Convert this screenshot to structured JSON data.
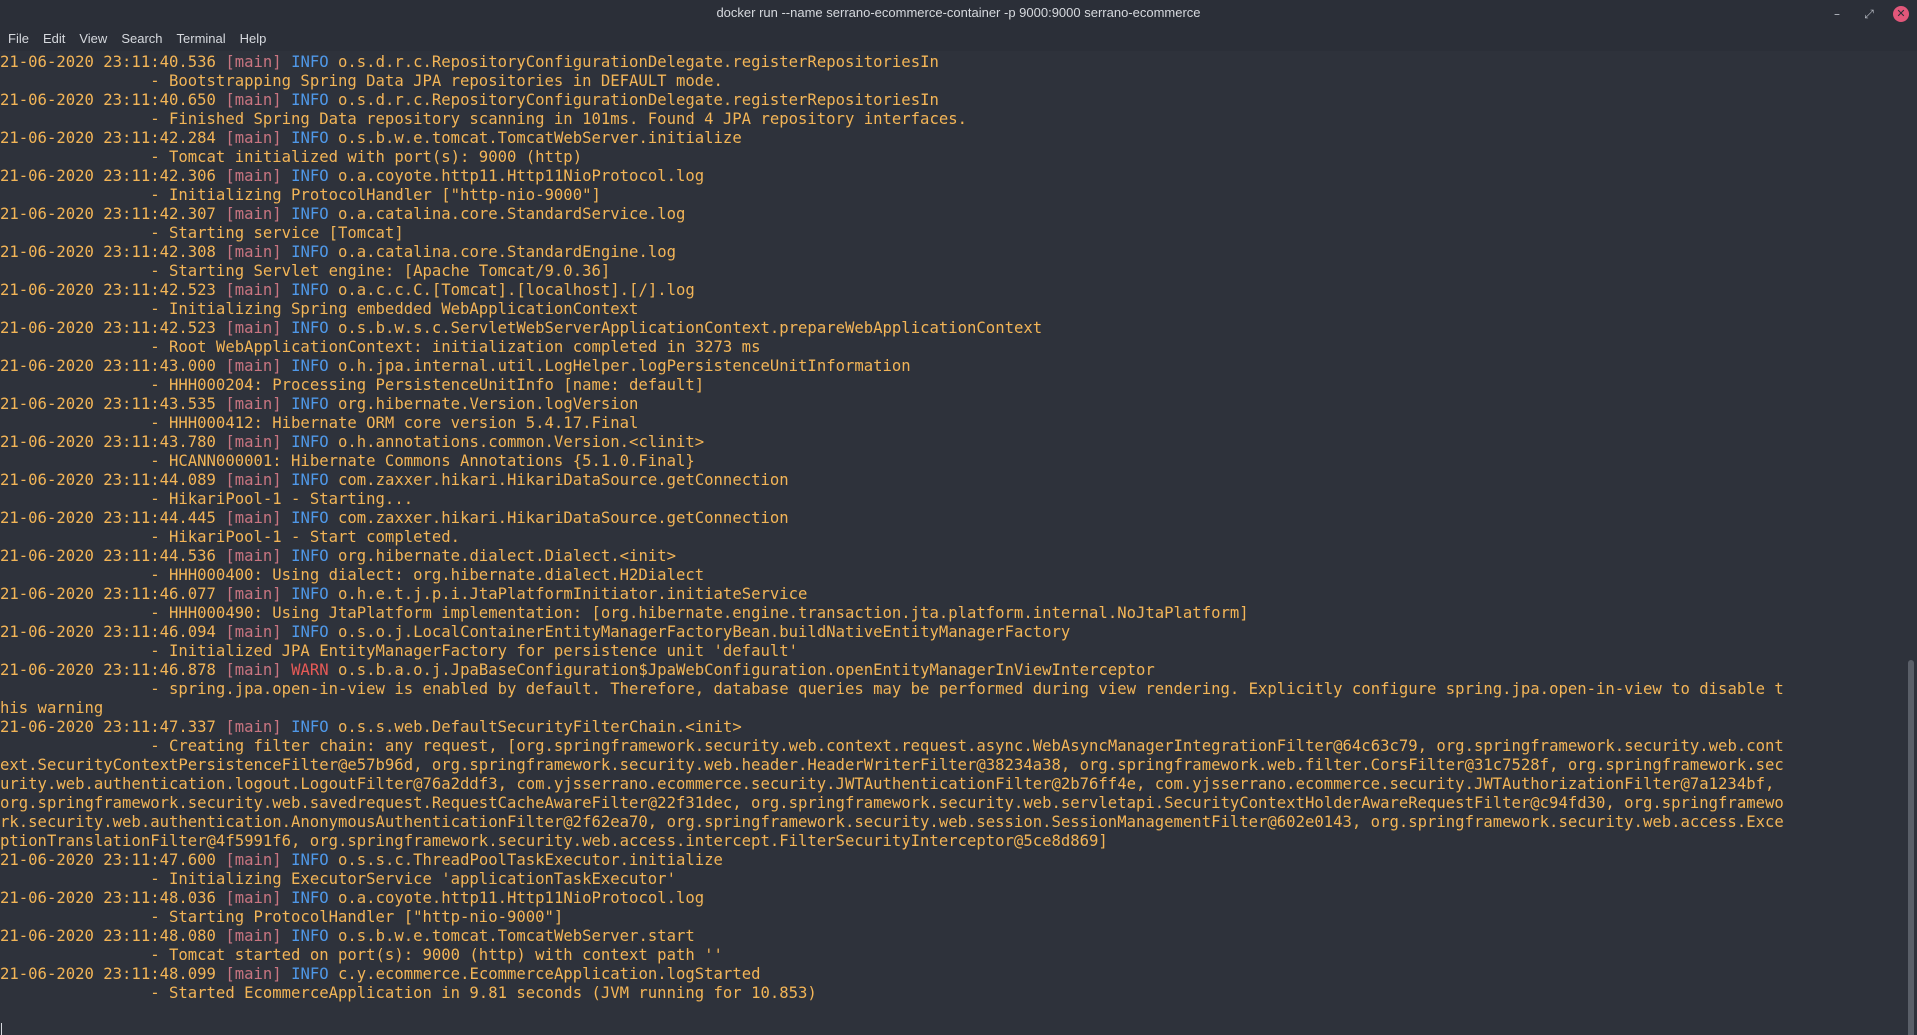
{
  "window": {
    "title": "docker run --name serrano-ecommerce-container -p 9000:9000 serrano-ecommerce",
    "controls": {
      "minimize": "–",
      "maximize": "⤢",
      "close": "✕"
    }
  },
  "menubar": {
    "items": [
      "File",
      "Edit",
      "View",
      "Search",
      "Terminal",
      "Help"
    ]
  },
  "colors": {
    "background": "#2e323b",
    "text": "#f3b557",
    "thread": "#c97581",
    "info": "#4f98e8",
    "warn": "#e65a57"
  },
  "terminal": {
    "indent": "                ",
    "lines": [
      {
        "type": "log",
        "ts": "21-06-2020 23:11:40.536",
        "thread": "[main]",
        "level": "INFO",
        "logger": "o.s.d.r.c.RepositoryConfigurationDelegate.registerRepositoriesIn"
      },
      {
        "type": "msg",
        "text": "- Bootstrapping Spring Data JPA repositories in DEFAULT mode."
      },
      {
        "type": "log",
        "ts": "21-06-2020 23:11:40.650",
        "thread": "[main]",
        "level": "INFO",
        "logger": "o.s.d.r.c.RepositoryConfigurationDelegate.registerRepositoriesIn"
      },
      {
        "type": "msg",
        "text": "- Finished Spring Data repository scanning in 101ms. Found 4 JPA repository interfaces."
      },
      {
        "type": "log",
        "ts": "21-06-2020 23:11:42.284",
        "thread": "[main]",
        "level": "INFO",
        "logger": "o.s.b.w.e.tomcat.TomcatWebServer.initialize"
      },
      {
        "type": "msg",
        "text": "- Tomcat initialized with port(s): 9000 (http)"
      },
      {
        "type": "log",
        "ts": "21-06-2020 23:11:42.306",
        "thread": "[main]",
        "level": "INFO",
        "logger": "o.a.coyote.http11.Http11NioProtocol.log"
      },
      {
        "type": "msg",
        "text": "- Initializing ProtocolHandler [\"http-nio-9000\"]"
      },
      {
        "type": "log",
        "ts": "21-06-2020 23:11:42.307",
        "thread": "[main]",
        "level": "INFO",
        "logger": "o.a.catalina.core.StandardService.log"
      },
      {
        "type": "msg",
        "text": "- Starting service [Tomcat]"
      },
      {
        "type": "log",
        "ts": "21-06-2020 23:11:42.308",
        "thread": "[main]",
        "level": "INFO",
        "logger": "o.a.catalina.core.StandardEngine.log"
      },
      {
        "type": "msg",
        "text": "- Starting Servlet engine: [Apache Tomcat/9.0.36]"
      },
      {
        "type": "log",
        "ts": "21-06-2020 23:11:42.523",
        "thread": "[main]",
        "level": "INFO",
        "logger": "o.a.c.c.C.[Tomcat].[localhost].[/].log"
      },
      {
        "type": "msg",
        "text": "- Initializing Spring embedded WebApplicationContext"
      },
      {
        "type": "log",
        "ts": "21-06-2020 23:11:42.523",
        "thread": "[main]",
        "level": "INFO",
        "logger": "o.s.b.w.s.c.ServletWebServerApplicationContext.prepareWebApplicationContext"
      },
      {
        "type": "msg",
        "text": "- Root WebApplicationContext: initialization completed in 3273 ms"
      },
      {
        "type": "log",
        "ts": "21-06-2020 23:11:43.000",
        "thread": "[main]",
        "level": "INFO",
        "logger": "o.h.jpa.internal.util.LogHelper.logPersistenceUnitInformation"
      },
      {
        "type": "msg",
        "text": "- HHH000204: Processing PersistenceUnitInfo [name: default]"
      },
      {
        "type": "log",
        "ts": "21-06-2020 23:11:43.535",
        "thread": "[main]",
        "level": "INFO",
        "logger": "org.hibernate.Version.logVersion"
      },
      {
        "type": "msg",
        "text": "- HHH000412: Hibernate ORM core version 5.4.17.Final"
      },
      {
        "type": "log",
        "ts": "21-06-2020 23:11:43.780",
        "thread": "[main]",
        "level": "INFO",
        "logger": "o.h.annotations.common.Version.<clinit>"
      },
      {
        "type": "msg",
        "text": "- HCANN000001: Hibernate Commons Annotations {5.1.0.Final}"
      },
      {
        "type": "log",
        "ts": "21-06-2020 23:11:44.089",
        "thread": "[main]",
        "level": "INFO",
        "logger": "com.zaxxer.hikari.HikariDataSource.getConnection"
      },
      {
        "type": "msg",
        "text": "- HikariPool-1 - Starting..."
      },
      {
        "type": "log",
        "ts": "21-06-2020 23:11:44.445",
        "thread": "[main]",
        "level": "INFO",
        "logger": "com.zaxxer.hikari.HikariDataSource.getConnection"
      },
      {
        "type": "msg",
        "text": "- HikariPool-1 - Start completed."
      },
      {
        "type": "log",
        "ts": "21-06-2020 23:11:44.536",
        "thread": "[main]",
        "level": "INFO",
        "logger": "org.hibernate.dialect.Dialect.<init>"
      },
      {
        "type": "msg",
        "text": "- HHH000400: Using dialect: org.hibernate.dialect.H2Dialect"
      },
      {
        "type": "log",
        "ts": "21-06-2020 23:11:46.077",
        "thread": "[main]",
        "level": "INFO",
        "logger": "o.h.e.t.j.p.i.JtaPlatformInitiator.initiateService"
      },
      {
        "type": "msg",
        "text": "- HHH000490: Using JtaPlatform implementation: [org.hibernate.engine.transaction.jta.platform.internal.NoJtaPlatform]"
      },
      {
        "type": "log",
        "ts": "21-06-2020 23:11:46.094",
        "thread": "[main]",
        "level": "INFO",
        "logger": "o.s.o.j.LocalContainerEntityManagerFactoryBean.buildNativeEntityManagerFactory"
      },
      {
        "type": "msg",
        "text": "- Initialized JPA EntityManagerFactory for persistence unit 'default'"
      },
      {
        "type": "log",
        "ts": "21-06-2020 23:11:46.878",
        "thread": "[main]",
        "level": "WARN",
        "logger": "o.s.b.a.o.j.JpaBaseConfiguration$JpaWebConfiguration.openEntityManagerInViewInterceptor"
      },
      {
        "type": "msg",
        "text": "- spring.jpa.open-in-view is enabled by default. Therefore, database queries may be performed during view rendering. Explicitly configure spring.jpa.open-in-view to disable t"
      },
      {
        "type": "raw",
        "text": "his warning"
      },
      {
        "type": "log",
        "ts": "21-06-2020 23:11:47.337",
        "thread": "[main]",
        "level": "INFO",
        "logger": "o.s.s.web.DefaultSecurityFilterChain.<init>"
      },
      {
        "type": "msg",
        "text": "- Creating filter chain: any request, [org.springframework.security.web.context.request.async.WebAsyncManagerIntegrationFilter@64c63c79, org.springframework.security.web.cont"
      },
      {
        "type": "raw",
        "text": "ext.SecurityContextPersistenceFilter@e57b96d, org.springframework.security.web.header.HeaderWriterFilter@38234a38, org.springframework.web.filter.CorsFilter@31c7528f, org.springframework.sec"
      },
      {
        "type": "raw",
        "text": "urity.web.authentication.logout.LogoutFilter@76a2ddf3, com.yjsserrano.ecommerce.security.JWTAuthenticationFilter@2b76ff4e, com.yjsserrano.ecommerce.security.JWTAuthorizationFilter@7a1234bf,"
      },
      {
        "type": "raw",
        "text": "org.springframework.security.web.savedrequest.RequestCacheAwareFilter@22f31dec, org.springframework.security.web.servletapi.SecurityContextHolderAwareRequestFilter@c94fd30, org.springframewo"
      },
      {
        "type": "raw",
        "text": "rk.security.web.authentication.AnonymousAuthenticationFilter@2f62ea70, org.springframework.security.web.session.SessionManagementFilter@602e0143, org.springframework.security.web.access.Exce"
      },
      {
        "type": "raw",
        "text": "ptionTranslationFilter@4f5991f6, org.springframework.security.web.access.intercept.FilterSecurityInterceptor@5ce8d869]"
      },
      {
        "type": "log",
        "ts": "21-06-2020 23:11:47.600",
        "thread": "[main]",
        "level": "INFO",
        "logger": "o.s.s.c.ThreadPoolTaskExecutor.initialize"
      },
      {
        "type": "msg",
        "text": "- Initializing ExecutorService 'applicationTaskExecutor'"
      },
      {
        "type": "log",
        "ts": "21-06-2020 23:11:48.036",
        "thread": "[main]",
        "level": "INFO",
        "logger": "o.a.coyote.http11.Http11NioProtocol.log"
      },
      {
        "type": "msg",
        "text": "- Starting ProtocolHandler [\"http-nio-9000\"]"
      },
      {
        "type": "log",
        "ts": "21-06-2020 23:11:48.080",
        "thread": "[main]",
        "level": "INFO",
        "logger": "o.s.b.w.e.tomcat.TomcatWebServer.start"
      },
      {
        "type": "msg",
        "text": "- Tomcat started on port(s): 9000 (http) with context path ''"
      },
      {
        "type": "log",
        "ts": "21-06-2020 23:11:48.099",
        "thread": "[main]",
        "level": "INFO",
        "logger": "c.y.ecommerce.EcommerceApplication.logStarted"
      },
      {
        "type": "msg",
        "text": "- Started EcommerceApplication in 9.81 seconds (JVM running for 10.853)"
      },
      {
        "type": "raw",
        "text": ""
      },
      {
        "type": "cursor",
        "text": ""
      }
    ]
  }
}
